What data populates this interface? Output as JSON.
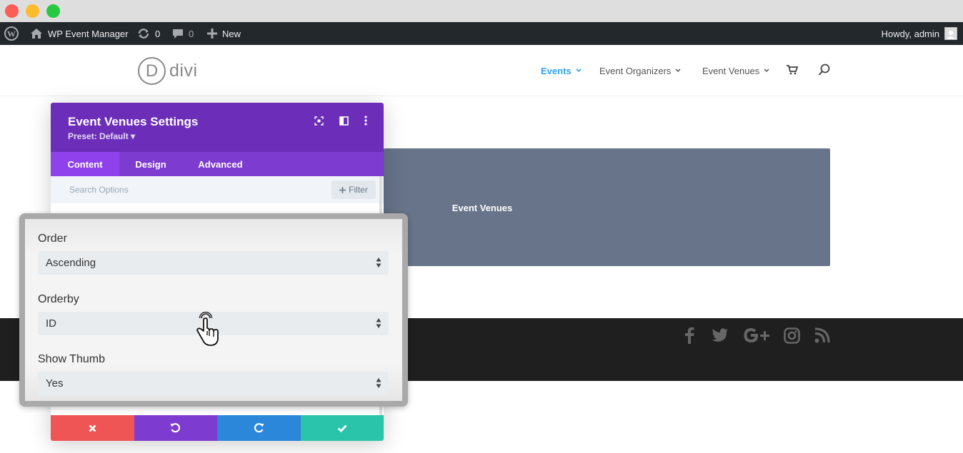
{
  "admin_bar": {
    "site_name": "WP Event Manager",
    "updates_count": "0",
    "comments_count": "0",
    "new_label": "New",
    "howdy": "Howdy, admin"
  },
  "site": {
    "logo_letter": "D",
    "logo_text": "divi",
    "nav": [
      {
        "label": "Events",
        "active": true
      },
      {
        "label": "Event Organizers",
        "active": false
      },
      {
        "label": "Event Venues",
        "active": false
      }
    ]
  },
  "content": {
    "venue_block_title": "Event Venues"
  },
  "panel": {
    "title": "Event Venues Settings",
    "preset": "Preset: Default ▾",
    "tabs": [
      "Content",
      "Design",
      "Advanced"
    ],
    "active_tab": "Content",
    "search_placeholder": "Search Options",
    "filter_label": "Filter"
  },
  "fields": {
    "order": {
      "label": "Order",
      "value": "Ascending"
    },
    "orderby": {
      "label": "Orderby",
      "value": "ID"
    },
    "show_thumb": {
      "label": "Show Thumb",
      "value": "Yes"
    }
  },
  "colors": {
    "panel_header": "#6c2eb9",
    "tabs_bar": "#7e3bd0",
    "active_nav": "#2ea3f2",
    "cancel": "#ef5555",
    "undo": "#7d3bcf",
    "redo": "#2b87da",
    "save": "#29c4a9"
  }
}
